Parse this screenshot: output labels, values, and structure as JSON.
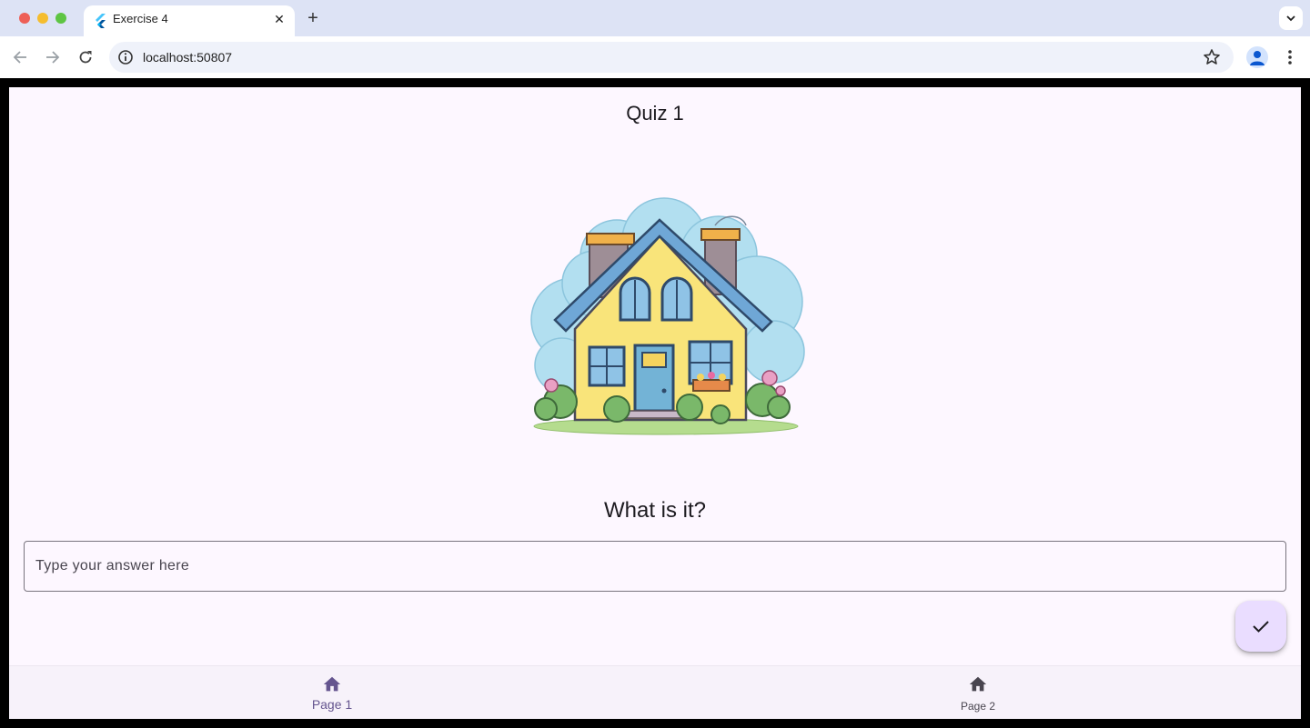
{
  "browser": {
    "tab_title": "Exercise 4",
    "tab_icon": "flutter-icon",
    "url": "localhost:50807"
  },
  "page": {
    "title": "Quiz 1",
    "illustration": "house-illustration",
    "question": "What is it?",
    "answer_placeholder": "Type your answer here",
    "answer_value": "",
    "submit_icon": "check-icon"
  },
  "bottom_nav": {
    "items": [
      {
        "label": "Page 1",
        "icon": "home-icon",
        "selected": true
      },
      {
        "label": "Page 2",
        "icon": "home-icon",
        "selected": false
      }
    ]
  },
  "colors": {
    "accent": "#65558f",
    "fab": "#eaddff",
    "background": "#fdf7ff",
    "nav_bar": "#f7f2fa"
  }
}
